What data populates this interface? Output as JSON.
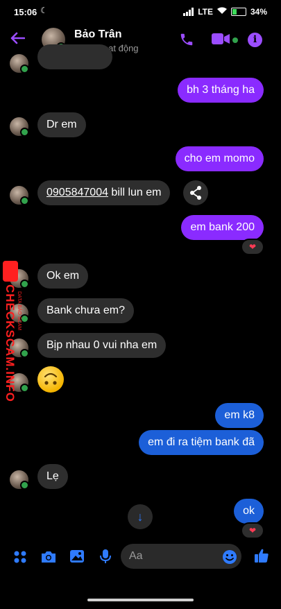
{
  "status_bar": {
    "time": "15:06",
    "network": "LTE",
    "battery": "34"
  },
  "header": {
    "contact_name": "Bảo Trân",
    "presence": "Đang hoạt động"
  },
  "messages": {
    "m1": "bh 3 tháng ha",
    "m2": "Dr em",
    "m3": "cho em momo",
    "m4_link": "0905847004",
    "m4_rest": " bill lun em",
    "m5": "em bank 200",
    "m6": "Ok em",
    "m7": "Bank chưa em?",
    "m8": "Bịp nhau 0 vui nha em",
    "m10": "em k8",
    "m11": "em đi ra tiệm bank đã",
    "m12": "Lẹ",
    "m13": "ok"
  },
  "watermark": {
    "main": "CHECKSCAM.INFO",
    "sub": "DATA BÁO SCAM"
  },
  "composer": {
    "placeholder": "Aa"
  },
  "colors": {
    "accent_purple": "#9b4dff",
    "outgoing_purple": "#8a2bff",
    "outgoing_blue": "#1c5fd8",
    "incoming": "#2e2e2e",
    "online": "#31a24c",
    "toolbar_blue": "#2f7bff"
  },
  "icons": [
    "back-arrow-icon",
    "phone-icon",
    "video-icon",
    "info-icon",
    "share-icon",
    "heart-reaction-icon",
    "scroll-down-icon",
    "apps-icon",
    "camera-icon",
    "image-icon",
    "mic-icon",
    "emoji-icon",
    "like-icon"
  ]
}
